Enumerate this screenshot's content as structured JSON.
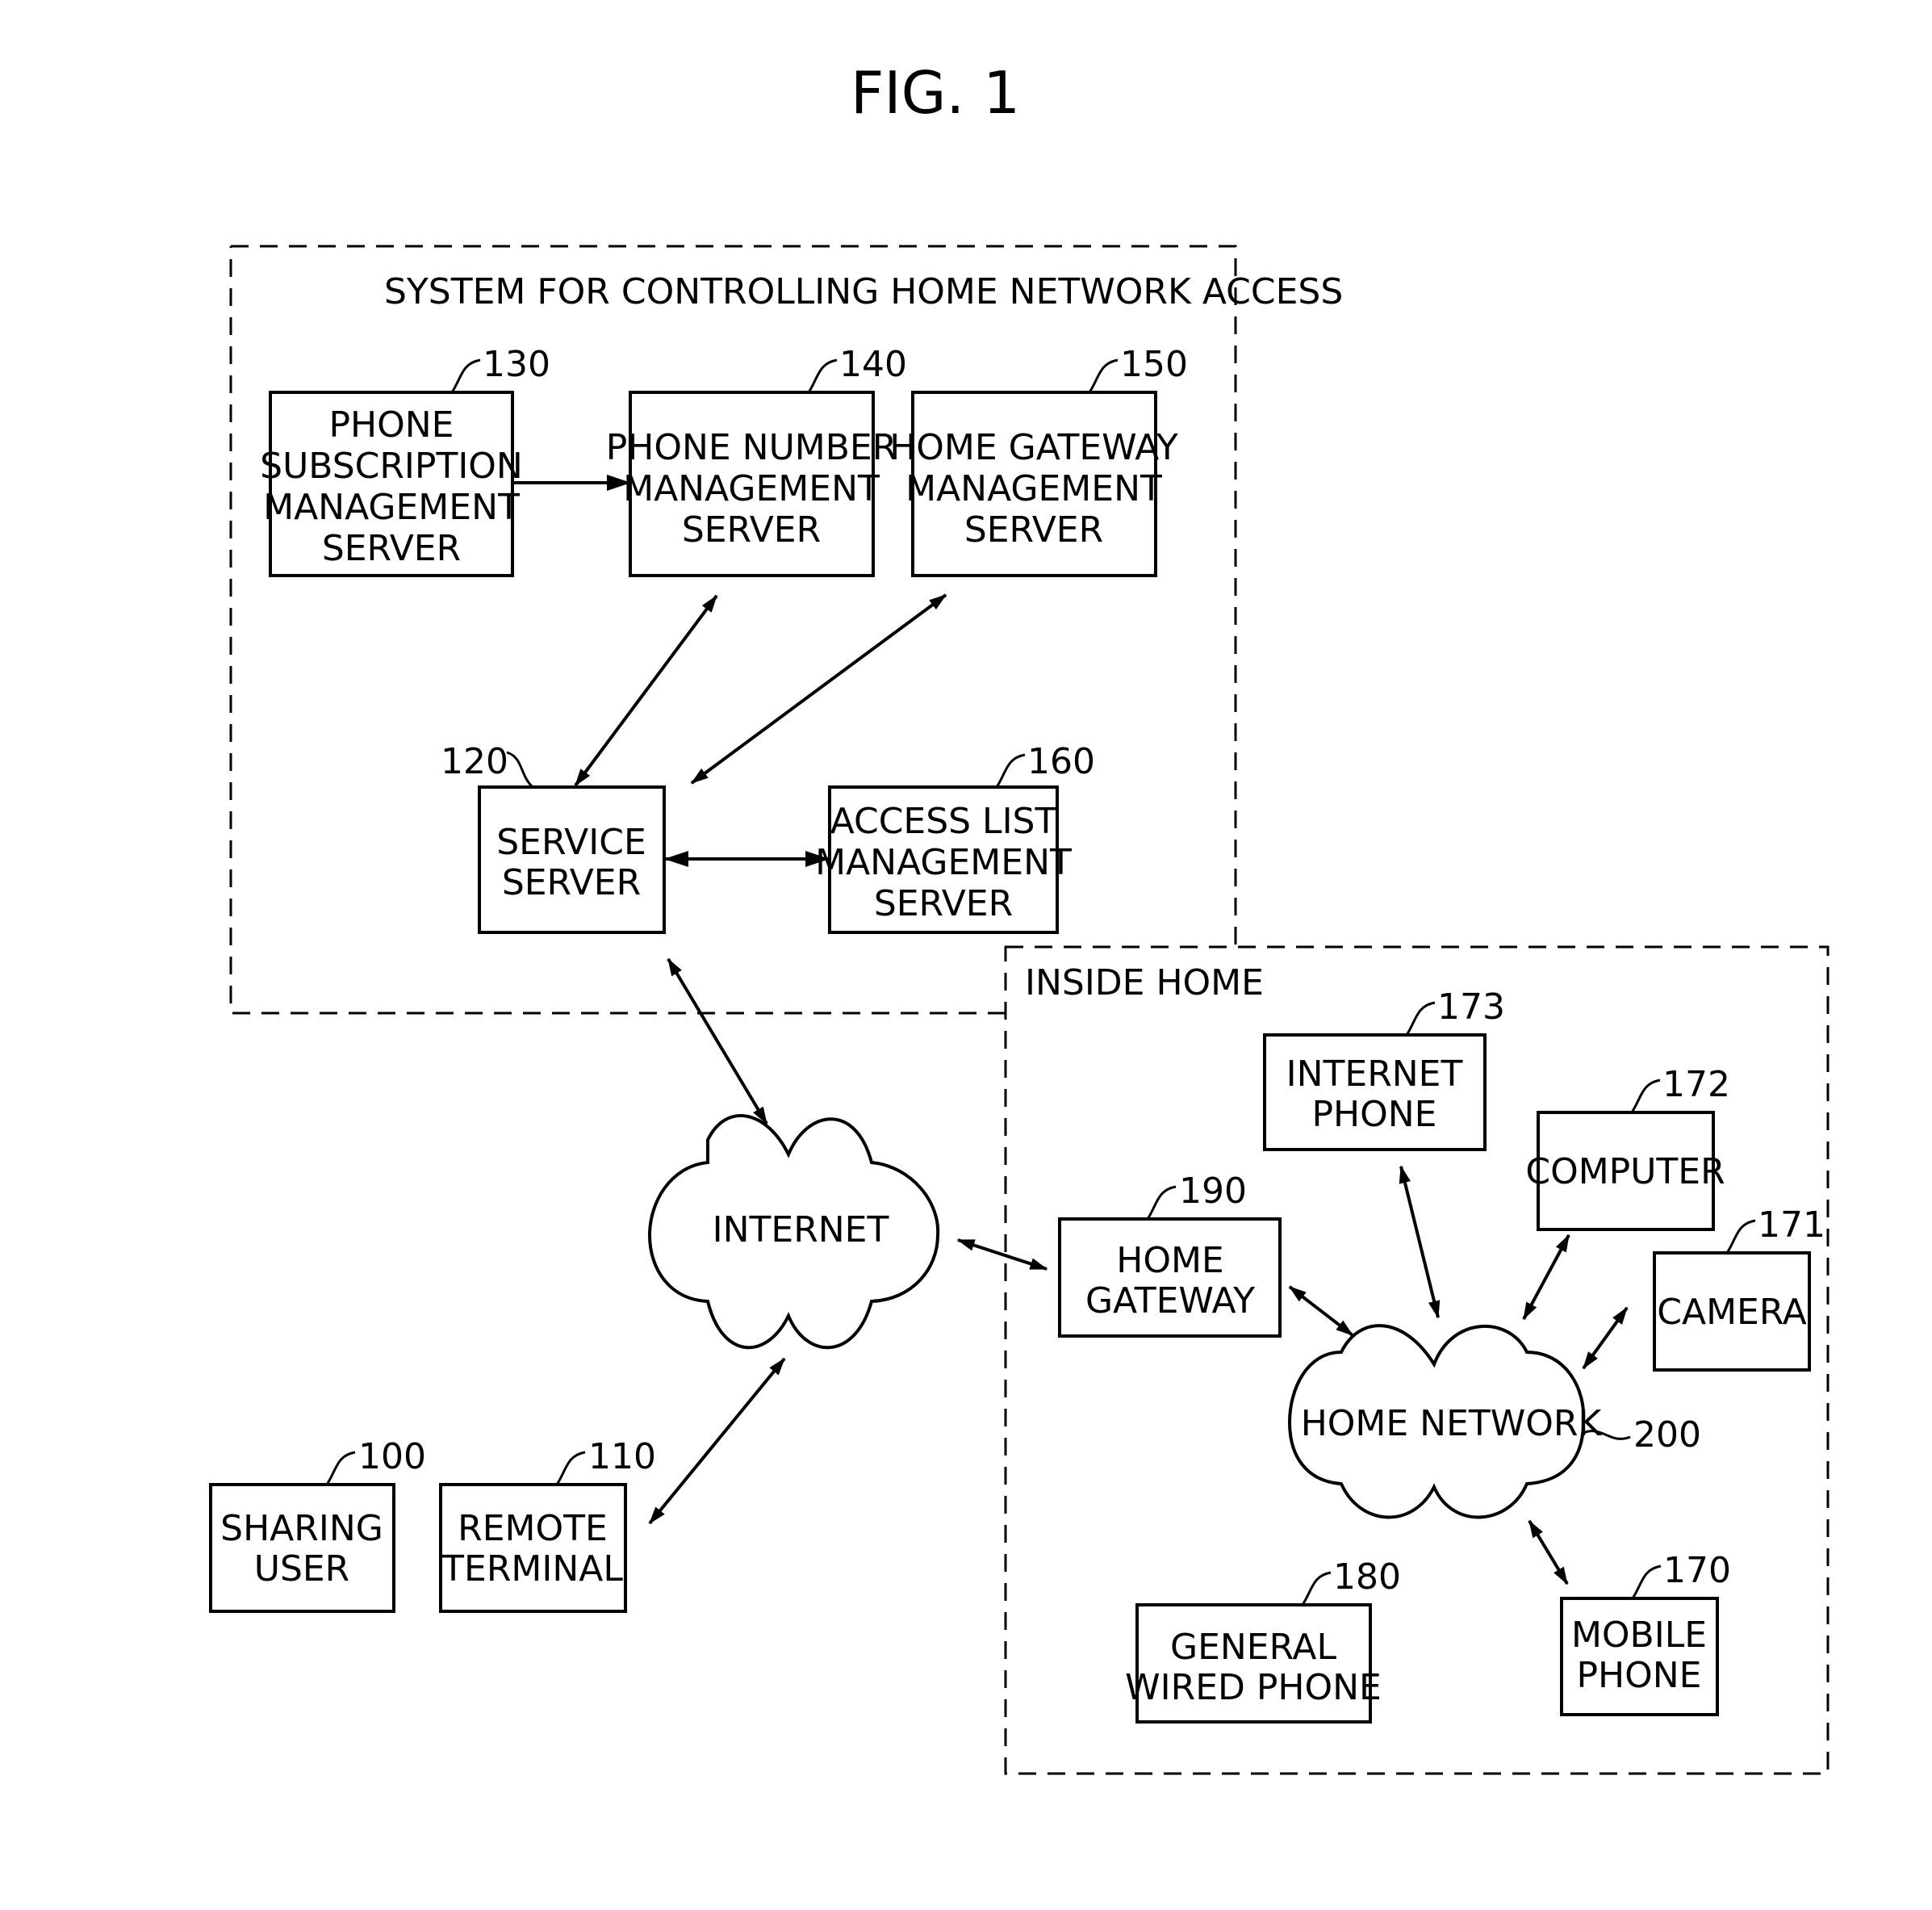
{
  "figure_title": "FIG. 1",
  "groups": {
    "system": {
      "label": "SYSTEM FOR CONTROLLING HOME NETWORK ACCESS"
    },
    "home": {
      "label": "INSIDE HOME"
    }
  },
  "nodes": {
    "phone_subscription": {
      "ref": "130",
      "lines": [
        "PHONE",
        "SUBSCRIPTION",
        "MANAGEMENT",
        "SERVER"
      ]
    },
    "phone_number": {
      "ref": "140",
      "lines": [
        "PHONE NUMBER",
        "MANAGEMENT",
        "SERVER"
      ]
    },
    "home_gateway_mgmt": {
      "ref": "150",
      "lines": [
        "HOME GATEWAY",
        "MANAGEMENT",
        "SERVER"
      ]
    },
    "service_server": {
      "ref": "120",
      "lines": [
        "SERVICE",
        "SERVER"
      ]
    },
    "access_list": {
      "ref": "160",
      "lines": [
        "ACCESS LIST",
        "MANAGEMENT",
        "SERVER"
      ]
    },
    "internet": {
      "lines": [
        "INTERNET"
      ]
    },
    "sharing_user": {
      "ref": "100",
      "lines": [
        "SHARING",
        "USER"
      ]
    },
    "remote_terminal": {
      "ref": "110",
      "lines": [
        "REMOTE",
        "TERMINAL"
      ]
    },
    "internet_phone": {
      "ref": "173",
      "lines": [
        "INTERNET",
        "PHONE"
      ]
    },
    "computer": {
      "ref": "172",
      "lines": [
        "COMPUTER"
      ]
    },
    "camera": {
      "ref": "171",
      "lines": [
        "CAMERA"
      ]
    },
    "home_gateway": {
      "ref": "190",
      "lines": [
        "HOME",
        "GATEWAY"
      ]
    },
    "home_network": {
      "ref": "200",
      "lines": [
        "HOME NETWORK"
      ]
    },
    "general_wired_phone": {
      "ref": "180",
      "lines": [
        "GENERAL",
        "WIRED PHONE"
      ]
    },
    "mobile_phone": {
      "ref": "170",
      "lines": [
        "MOBILE",
        "PHONE"
      ]
    }
  },
  "connections": [
    {
      "from": "phone_subscription",
      "to": "phone_number",
      "direction": "one-way"
    },
    {
      "from": "service_server",
      "to": "phone_number",
      "direction": "two-way"
    },
    {
      "from": "service_server",
      "to": "home_gateway_mgmt",
      "direction": "two-way"
    },
    {
      "from": "service_server",
      "to": "access_list",
      "direction": "two-way"
    },
    {
      "from": "service_server",
      "to": "internet",
      "direction": "two-way"
    },
    {
      "from": "remote_terminal",
      "to": "internet",
      "direction": "two-way"
    },
    {
      "from": "internet",
      "to": "home_gateway",
      "direction": "two-way"
    },
    {
      "from": "home_gateway",
      "to": "home_network",
      "direction": "two-way"
    },
    {
      "from": "internet_phone",
      "to": "home_network",
      "direction": "two-way"
    },
    {
      "from": "computer",
      "to": "home_network",
      "direction": "two-way"
    },
    {
      "from": "camera",
      "to": "home_network",
      "direction": "two-way"
    },
    {
      "from": "mobile_phone",
      "to": "home_network",
      "direction": "two-way"
    }
  ]
}
